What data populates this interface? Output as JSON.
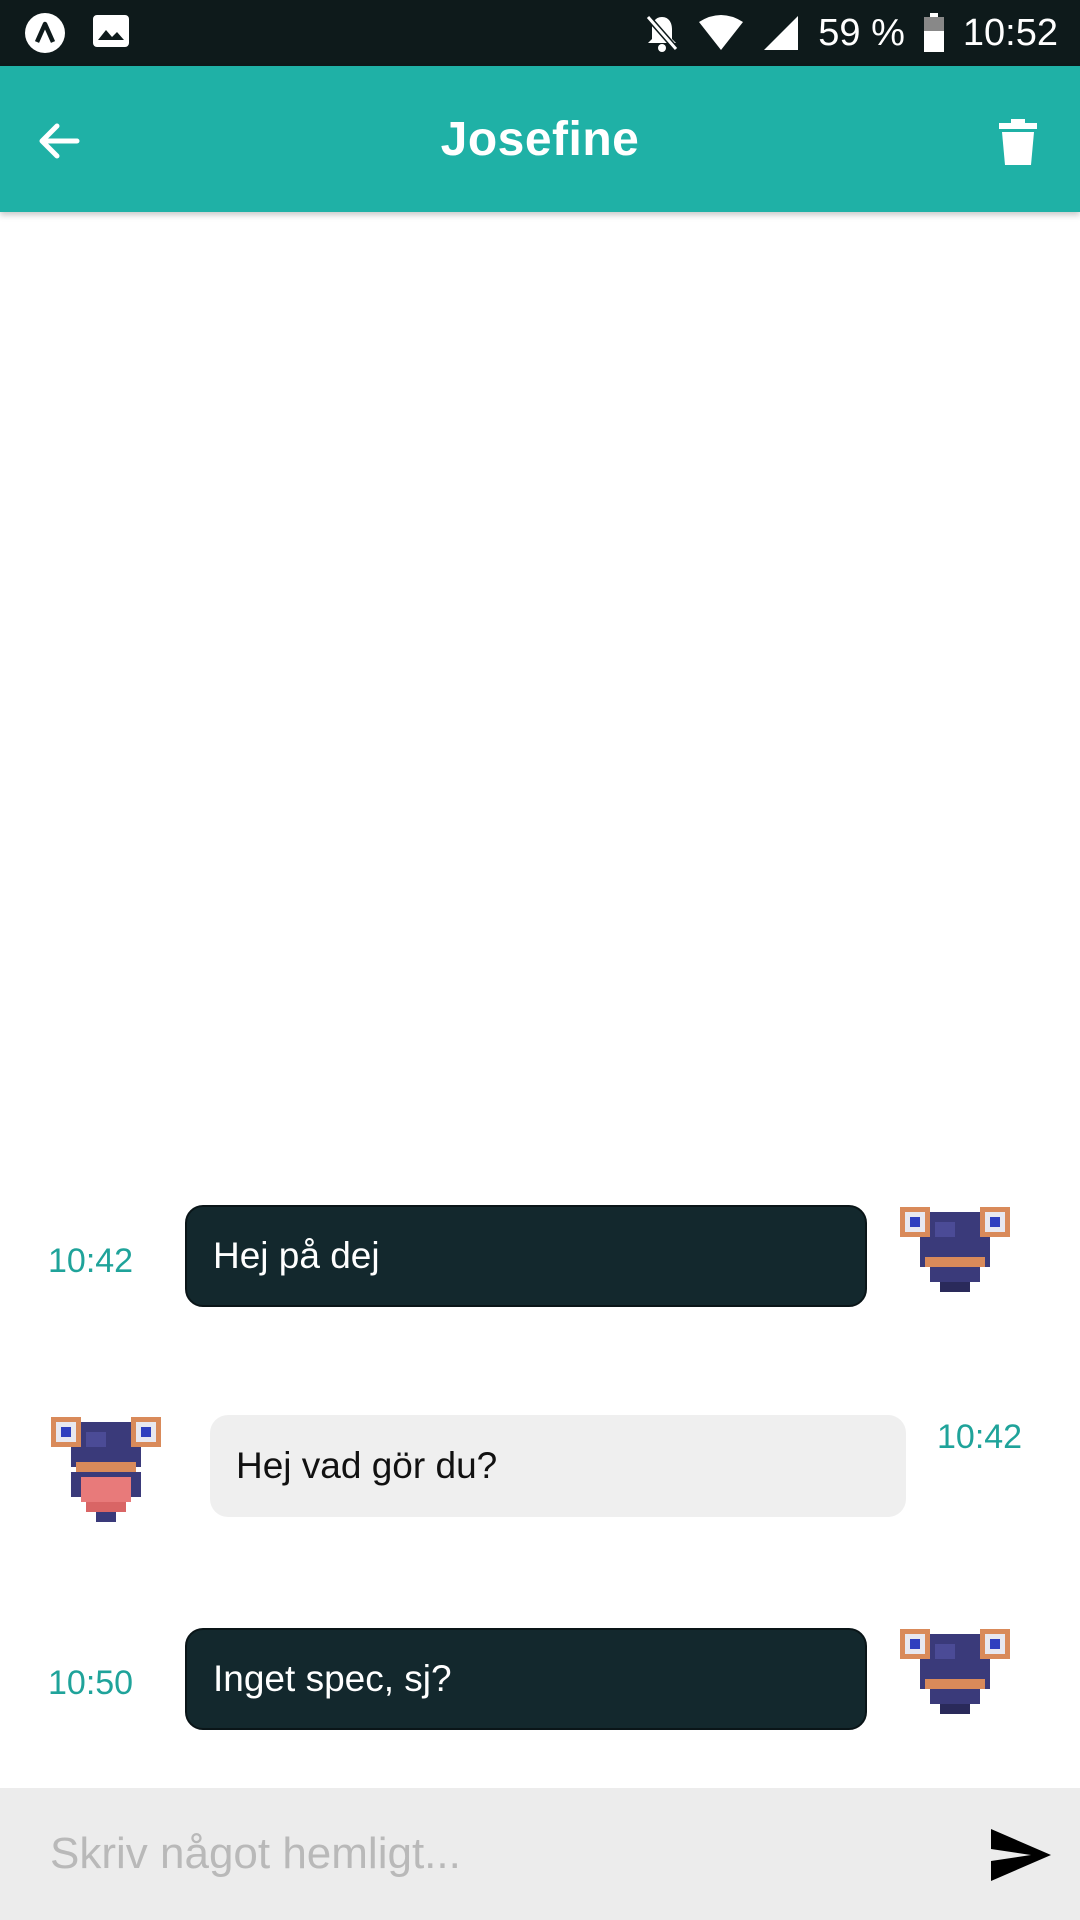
{
  "status_bar": {
    "left_icons": [
      "app-notification-icon",
      "image-notification-icon"
    ],
    "right_icons": [
      "bell-off-icon",
      "wifi-icon",
      "cell-signal-icon",
      "battery-icon"
    ],
    "battery": "59 %",
    "time": "10:52"
  },
  "header": {
    "title": "Josefine",
    "back_icon": "arrow-left-icon",
    "delete_icon": "trash-icon",
    "color": "#1fb1a6"
  },
  "messages": [
    {
      "direction": "outgoing",
      "time": "10:42",
      "text": "Hej på dej",
      "avatar_icon": "pixel-creature-avatar"
    },
    {
      "direction": "incoming",
      "time": "10:42",
      "text": "Hej vad gör du?",
      "avatar_icon": "pixel-creature-avatar"
    },
    {
      "direction": "outgoing",
      "time": "10:50",
      "text": "Inget spec, sj?",
      "avatar_icon": "pixel-creature-avatar"
    }
  ],
  "composer": {
    "placeholder": "Skriv något hemligt...",
    "value": "",
    "send_icon": "send-icon"
  },
  "colors": {
    "accent": "#1fb1a6",
    "timestamp": "#1fa39a",
    "outgoing_bubble": "#13282d",
    "incoming_bubble": "#efefef"
  }
}
